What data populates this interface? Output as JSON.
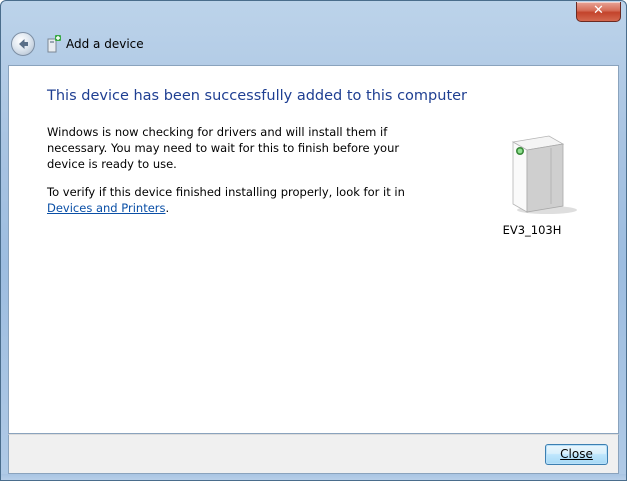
{
  "window": {
    "title": "Add a device",
    "close_glyph": "✕"
  },
  "content": {
    "heading": "This device has been successfully added to this computer",
    "paragraph1": "Windows is now checking for drivers and will install them if necessary. You may need to wait for this to finish before your device is ready to use.",
    "paragraph2_prefix": "To verify if this device finished installing properly, look for it in",
    "link_text": "Devices and Printers",
    "paragraph2_suffix": "."
  },
  "device": {
    "name": "EV3_103H",
    "icon": "device-tower-icon"
  },
  "footer": {
    "close_label": "Close"
  },
  "colors": {
    "heading": "#1f3f92",
    "link": "#0a4fa6",
    "titlebar": "#a9c4e2",
    "close_red": "#c3432b"
  }
}
